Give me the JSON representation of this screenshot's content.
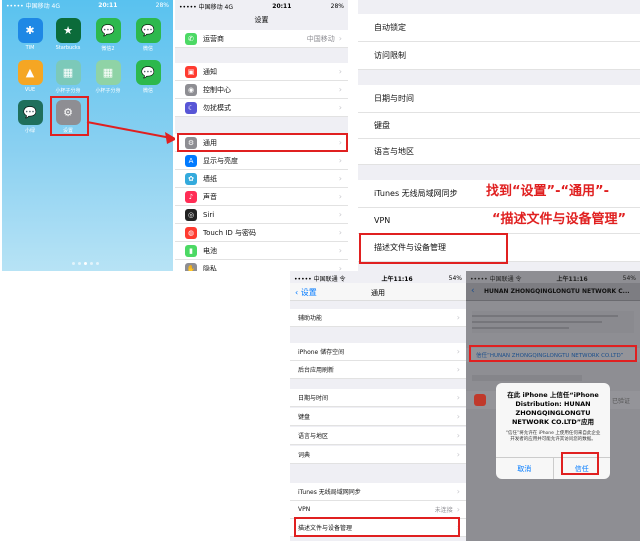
{
  "home": {
    "status": {
      "carrier": "••••• 中国移动 4G",
      "time": "20:11",
      "battery": "28%"
    },
    "apps": [
      {
        "label": "TIM",
        "icon": "star-icon",
        "color": "#1e88e5",
        "glyph": "✱"
      },
      {
        "label": "Starbucks",
        "icon": "starbucks-icon",
        "color": "#0b6b3a",
        "glyph": "★"
      },
      {
        "label": "微信2",
        "icon": "wechat-icon",
        "color": "#2db84d",
        "glyph": "💬"
      },
      {
        "label": "微信",
        "icon": "wechat-icon",
        "color": "#2db84d",
        "glyph": "💬"
      },
      {
        "label": "VUE",
        "icon": "vue-icon",
        "color": "#f5a623",
        "glyph": "▲"
      },
      {
        "label": "小杯子分身",
        "icon": "folder-icon",
        "color": "#7cc9b9",
        "glyph": "▦"
      },
      {
        "label": "小杯子分身",
        "icon": "folder-icon",
        "color": "#8fd3a6",
        "glyph": "▦"
      },
      {
        "label": "微信",
        "icon": "wechat-icon",
        "color": "#2db84d",
        "glyph": "💬"
      },
      {
        "label": "小绿",
        "icon": "wechat-icon",
        "color": "#1f6f5c",
        "glyph": "💬"
      },
      {
        "label": "设置",
        "icon": "gear-icon",
        "color": "#8e8e93",
        "glyph": "⚙"
      }
    ]
  },
  "settings": {
    "status": {
      "carrier": "••••• 中国移动 4G",
      "time": "20:11",
      "battery": "28%"
    },
    "title": "设置",
    "rows": [
      {
        "label": "运营商",
        "value": "中国移动",
        "icon": "carrier-icon",
        "color": "#4cd964",
        "glyph": "✆"
      },
      {
        "label": "通知",
        "value": "",
        "icon": "notification-icon",
        "color": "#ff3b30",
        "glyph": "▣"
      },
      {
        "label": "控制中心",
        "value": "",
        "icon": "control-center-icon",
        "color": "#8e8e93",
        "glyph": "◉"
      },
      {
        "label": "勿扰模式",
        "value": "",
        "icon": "moon-icon",
        "color": "#5856d6",
        "glyph": "☾"
      },
      {
        "label": "通用",
        "value": "",
        "icon": "gear-icon",
        "color": "#8e8e93",
        "glyph": "⚙"
      },
      {
        "label": "显示与亮度",
        "value": "",
        "icon": "display-icon",
        "color": "#007aff",
        "glyph": "A"
      },
      {
        "label": "墙纸",
        "value": "",
        "icon": "wallpaper-icon",
        "color": "#34aadc",
        "glyph": "✿"
      },
      {
        "label": "声音",
        "value": "",
        "icon": "sound-icon",
        "color": "#ff2d55",
        "glyph": "♪"
      },
      {
        "label": "Siri",
        "value": "",
        "icon": "siri-icon",
        "color": "#222222",
        "glyph": "◎"
      },
      {
        "label": "Touch ID 与密码",
        "value": "",
        "icon": "fingerprint-icon",
        "color": "#ff3b30",
        "glyph": "◍"
      },
      {
        "label": "电池",
        "value": "",
        "icon": "battery-icon",
        "color": "#4cd964",
        "glyph": "▮"
      },
      {
        "label": "隐私",
        "value": "",
        "icon": "privacy-icon",
        "color": "#8e8e93",
        "glyph": "✋"
      }
    ]
  },
  "general_top": {
    "rows": [
      "自动锁定",
      "访问限制",
      "日期与时间",
      "键盘",
      "语言与地区",
      "iTunes 无线局域网同步",
      "VPN",
      "描述文件与设备管理"
    ]
  },
  "instruction": {
    "line1": "找到“设置”-“通用”-",
    "line2": "“描述文件与设备管理”"
  },
  "general_bottom": {
    "status": {
      "carrier": "••••• 中国联通 令",
      "time": "上午11:16",
      "battery": "54%"
    },
    "back": "设置",
    "title": "通用",
    "rows": [
      {
        "label": "辅助功能",
        "value": ""
      },
      {
        "label": "iPhone 储存空间",
        "value": ""
      },
      {
        "label": "后台应用刷新",
        "value": ""
      },
      {
        "label": "日期与时间",
        "value": ""
      },
      {
        "label": "键盘",
        "value": ""
      },
      {
        "label": "语言与地区",
        "value": ""
      },
      {
        "label": "词典",
        "value": ""
      },
      {
        "label": "iTunes 无线局域网同步",
        "value": ""
      },
      {
        "label": "VPN",
        "value": "未连接"
      },
      {
        "label": "描述文件与设备管理",
        "value": ""
      }
    ]
  },
  "profile": {
    "status": {
      "carrier": "••••• 中国联通 令",
      "time": "上午11:16",
      "battery": "54%"
    },
    "title": "HUNAN ZHONGQINGLONGTU NETWORK C...",
    "trust_link": "信任“HUNAN ZHONGQINGLONGTU NETWORK CO.LTD”",
    "verified": "已验证",
    "dialog": {
      "title": "在此 iPhone 上信任“iPhone Distribution: HUNAN ZHONGQINGLONGTU NETWORK CO.LTD”应用",
      "body": "“信任”将允许在 iPhone 上使用任何来自此企业开发者的应用并可能允许其访问您的数据。",
      "cancel": "取消",
      "trust": "信任"
    }
  }
}
